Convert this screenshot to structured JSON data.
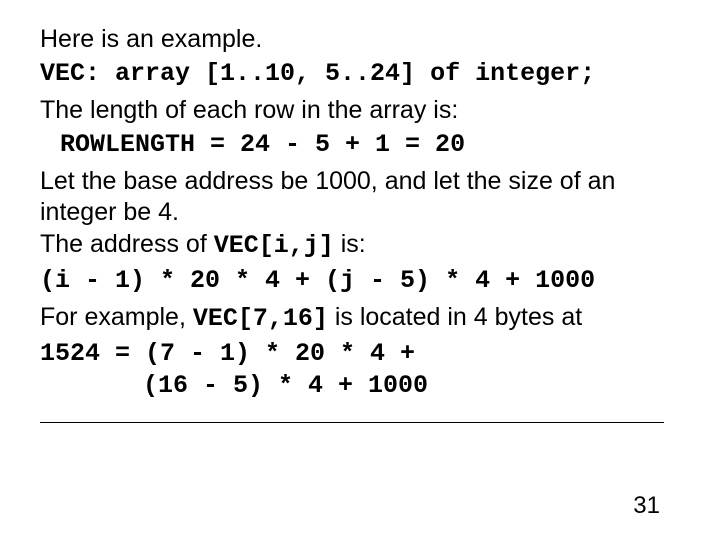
{
  "lines": {
    "l1": "Here is an example.",
    "l2": "VEC: array [1..10, 5..24] of integer;",
    "l3": "The length of each row in the array is:",
    "l4": "ROWLENGTH = 24 - 5 + 1 = 20",
    "l5": "Let the base address be 1000, and let the size of an integer be 4.",
    "l6a": "The address of ",
    "l6b": "VEC[i,j]",
    "l6c": " is:",
    "l7": "(i - 1) * 20 * 4 + (j - 5) * 4 + 1000",
    "l8a": "For example, ",
    "l8b": "VEC[7,16]",
    "l8c": " is located in 4 bytes at",
    "l9": "1524 = (7 - 1) * 20 * 4 +",
    "l10": "(16 - 5) * 4 + 1000"
  },
  "page_number": "31"
}
